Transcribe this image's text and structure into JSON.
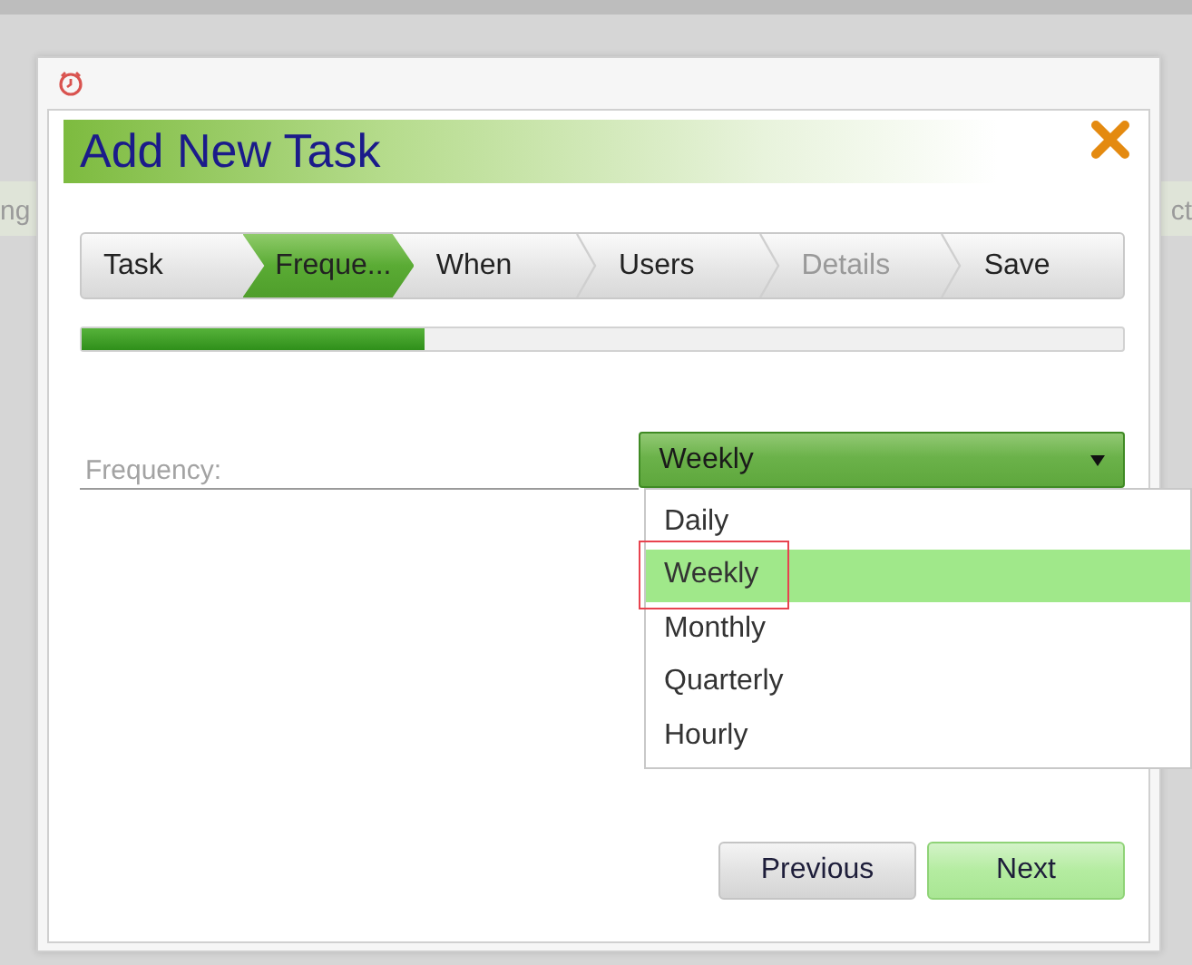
{
  "background": {
    "fragments": [
      "ng",
      "ct"
    ]
  },
  "dialog": {
    "title": "Add New Task",
    "steps": [
      {
        "label": "Task",
        "selected": false,
        "disabled": false
      },
      {
        "label": "Freque...",
        "selected": true,
        "disabled": false
      },
      {
        "label": "When",
        "selected": false,
        "disabled": false
      },
      {
        "label": "Users",
        "selected": false,
        "disabled": false
      },
      {
        "label": "Details",
        "selected": false,
        "disabled": true
      },
      {
        "label": "Save",
        "selected": false,
        "disabled": false
      }
    ],
    "progress": {
      "level": 0.33
    },
    "field": {
      "label": "Frequency:",
      "value": "Weekly",
      "options": [
        {
          "label": "Daily",
          "selected": false,
          "annotated": false
        },
        {
          "label": "Weekly",
          "selected": true,
          "annotated": true
        },
        {
          "label": "Monthly",
          "selected": false,
          "annotated": false
        },
        {
          "label": "Quarterly",
          "selected": false,
          "annotated": false
        },
        {
          "label": "Hourly",
          "selected": false,
          "annotated": false
        }
      ]
    },
    "buttons": [
      {
        "label": "Previous",
        "kind": "secondary"
      },
      {
        "label": "Next",
        "kind": "primary"
      }
    ]
  }
}
